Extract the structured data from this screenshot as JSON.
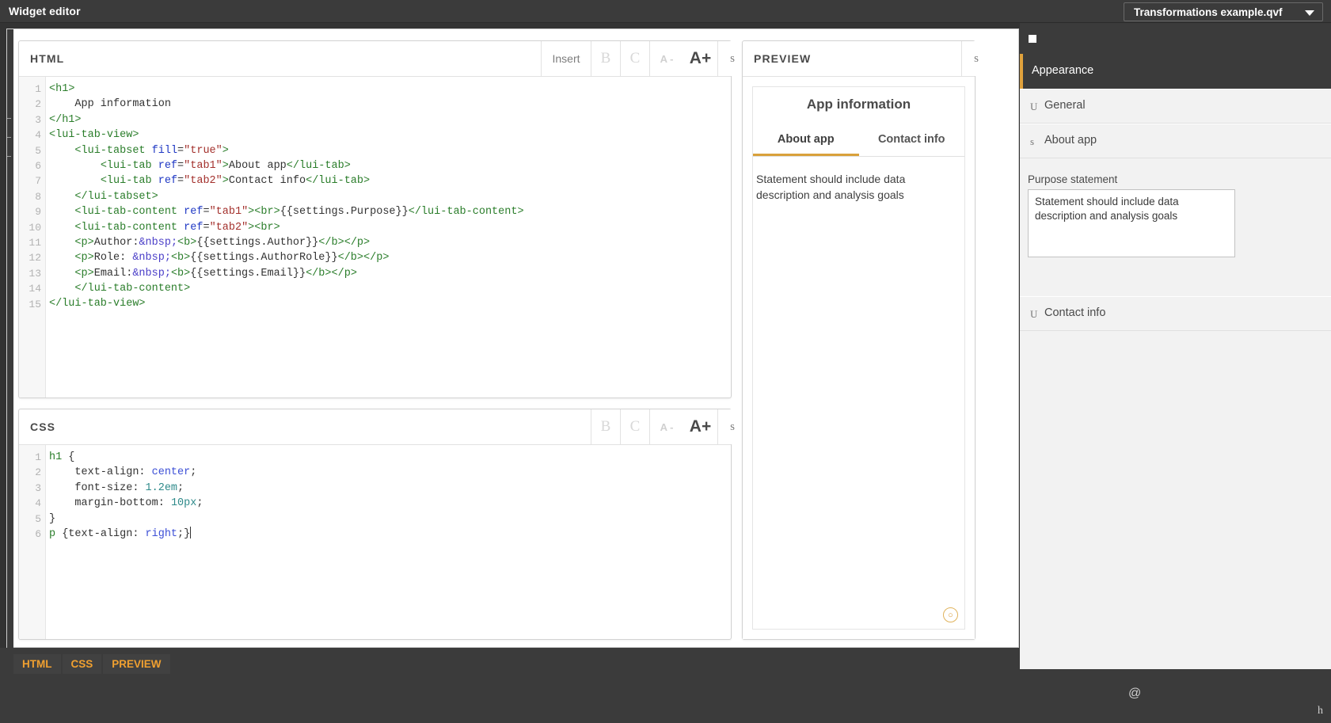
{
  "topbar": {
    "title": "Widget editor",
    "app_name": "Transformations example.qvf",
    "caret_icon": "chevron-down-icon"
  },
  "html_panel": {
    "title": "HTML",
    "toolbar": {
      "insert": "Insert",
      "bold": "B",
      "comment": "C",
      "font_decrease": "A -",
      "font_increase": "A+",
      "settings": "s"
    },
    "line_numbers": [
      "1",
      "2",
      "3",
      "4",
      "5",
      "6",
      "7",
      "8",
      "9",
      "10",
      "11",
      "12",
      "13",
      "14",
      "15"
    ],
    "code": [
      "<h1>",
      "    App information",
      "</h1>",
      "<lui-tab-view>",
      "    <lui-tabset fill=\"true\">",
      "        <lui-tab ref=\"tab1\">About app</lui-tab>",
      "        <lui-tab ref=\"tab2\">Contact info</lui-tab>",
      "    </lui-tabset>",
      "    <lui-tab-content ref=\"tab1\"><br>{{settings.Purpose}}</lui-tab-content>",
      "    <lui-tab-content ref=\"tab2\"><br>",
      "    <p>Author:&nbsp;<b>{{settings.Author}}</b></p>",
      "    <p>Role: &nbsp;<b>{{settings.AuthorRole}}</b></p>",
      "    <p>Email:&nbsp;<b>{{settings.Email}}</b></p>",
      "    </lui-tab-content>",
      "</lui-tab-view>"
    ]
  },
  "css_panel": {
    "title": "CSS",
    "toolbar": {
      "bold": "B",
      "comment": "C",
      "font_decrease": "A -",
      "font_increase": "A+",
      "settings": "s"
    },
    "line_numbers": [
      "1",
      "2",
      "3",
      "4",
      "5",
      "6"
    ],
    "code": [
      "h1 {",
      "    text-align: center;",
      "    font-size: 1.2em;",
      "    margin-bottom: 10px;",
      "}",
      "p {text-align: right;}"
    ]
  },
  "preview_panel": {
    "title": "PREVIEW",
    "toolbar": {
      "settings": "s"
    },
    "heading": "App information",
    "tabs": [
      {
        "label": "About app",
        "active": true
      },
      {
        "label": "Contact info",
        "active": false
      }
    ],
    "content": "Statement should include data description and analysis goals",
    "badge_icon": "info-circle-icon"
  },
  "sidebar": {
    "square_icon": "stop-square-icon",
    "section_title": "Appearance",
    "rows": [
      {
        "icon": "collapse-icon",
        "icon_glyph": "U",
        "label": "General"
      },
      {
        "icon": "expand-icon",
        "icon_glyph": "s",
        "label": "About app"
      }
    ],
    "field": {
      "label": "Purpose statement",
      "value": "Statement should include data description and analysis goals",
      "placeholder": ""
    },
    "bottom_row": {
      "icon": "collapse-icon",
      "icon_glyph": "U",
      "label": "Contact info"
    },
    "footer": {
      "at_icon": "@",
      "h_icon": "h"
    }
  },
  "bottombar": {
    "tabs": [
      "HTML",
      "CSS",
      "PREVIEW"
    ]
  },
  "colors": {
    "accent": "#e0a23c",
    "dark": "#3b3b3b",
    "tab_underline": "#d9a13b",
    "tag": "#2a7d2a",
    "attr": "#1f38c4",
    "string": "#a3302c"
  }
}
